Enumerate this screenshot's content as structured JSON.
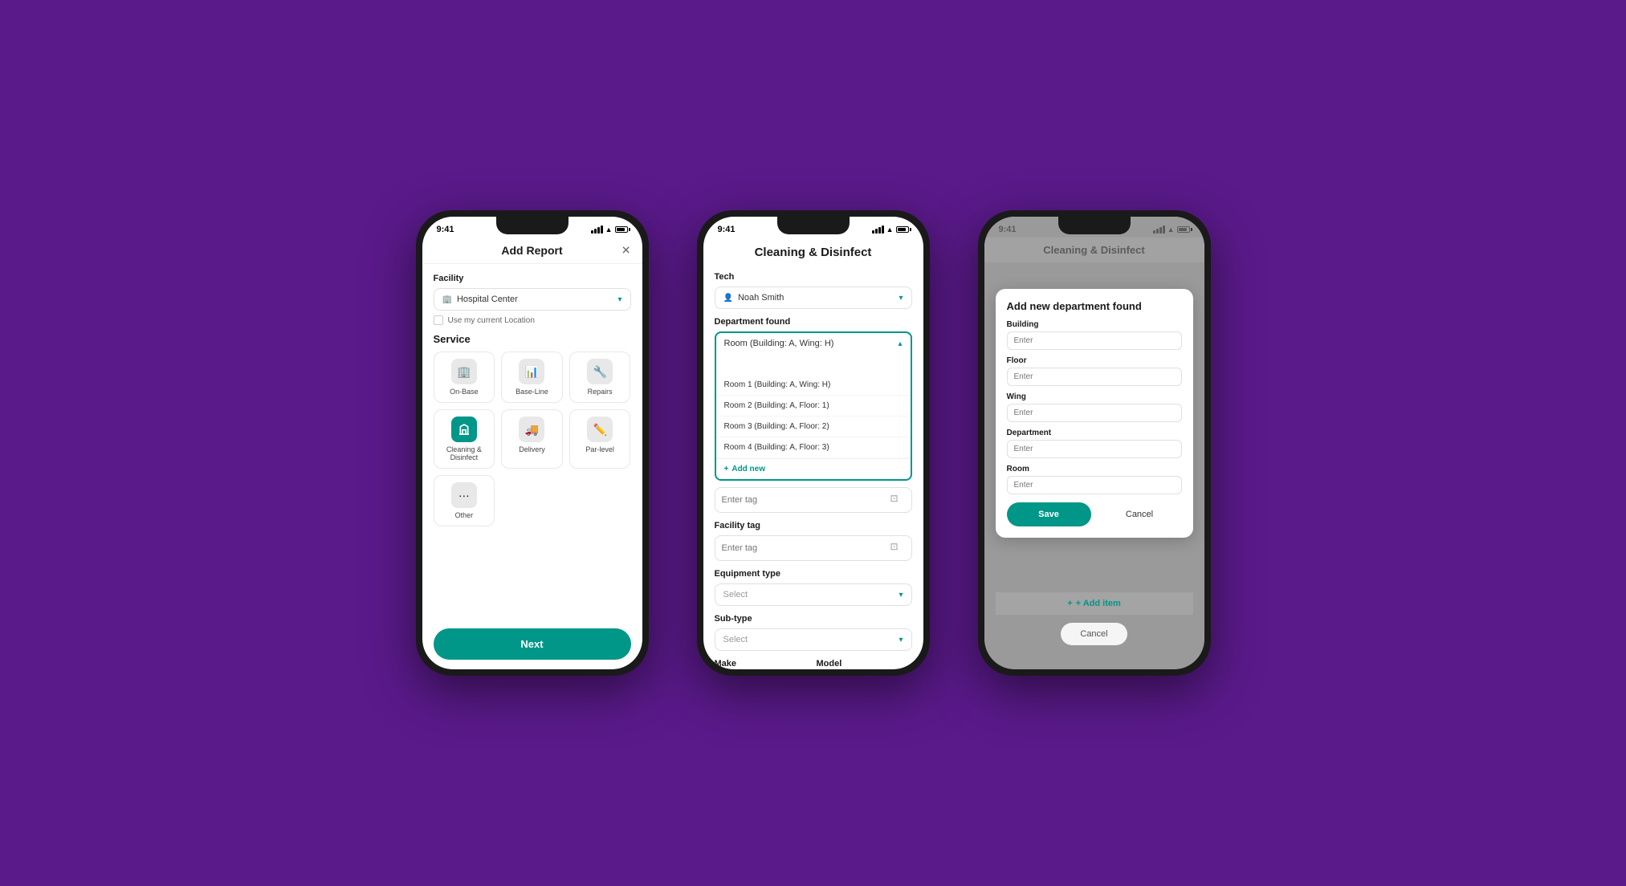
{
  "background": "#5a1a8a",
  "phone1": {
    "status_time": "9:41",
    "title": "Add Report",
    "facility_label": "Facility",
    "facility_value": "Hospital Center",
    "use_location_label": "Use my current Location",
    "service_label": "Service",
    "services": [
      {
        "name": "On-Base",
        "icon": "🏢",
        "teal": false
      },
      {
        "name": "Base-Line",
        "icon": "📊",
        "teal": false
      },
      {
        "name": "Repairs",
        "icon": "🔧",
        "teal": false
      },
      {
        "name": "Cleaning & Disinfect",
        "icon": "🧹",
        "teal": true
      },
      {
        "name": "Delivery",
        "icon": "🚚",
        "teal": false
      },
      {
        "name": "Par-level",
        "icon": "✏️",
        "teal": false
      },
      {
        "name": "Other",
        "icon": "···",
        "teal": false
      }
    ],
    "next_label": "Next"
  },
  "phone2": {
    "status_time": "9:41",
    "title": "Cleaning & Disinfect",
    "tech_label": "Tech",
    "tech_value": "Noah Smith",
    "department_label": "Department found",
    "department_value": "Room (Building: A, Wing: H)",
    "search_placeholder": "",
    "dropdown_items": [
      "Room 1 (Building: A, Wing: H)",
      "Room 2 (Building: A, Floor: 1)",
      "Room 3 (Building: A, Floor: 2)",
      "Room 4 (Building: A, Floor: 3)"
    ],
    "add_new_label": "Add new",
    "enter_tag_placeholder": "Enter tag",
    "facility_tag_label": "Facility tag",
    "equipment_type_label": "Equipment type",
    "equipment_type_placeholder": "Select",
    "sub_type_label": "Sub-type",
    "sub_type_placeholder": "Select",
    "make_label": "Make",
    "model_label": "Model"
  },
  "phone3": {
    "status_time": "9:41",
    "bg_title": "Cleaning & Disinfect",
    "modal_title": "Add new department found",
    "building_label": "Building",
    "building_placeholder": "Enter",
    "floor_label": "Floor",
    "floor_placeholder": "Enter",
    "wing_label": "Wing",
    "wing_placeholder": "Enter",
    "department_label": "Department",
    "department_placeholder": "Enter",
    "room_label": "Room",
    "room_placeholder": "Enter",
    "save_label": "Save",
    "cancel_label": "Cancel",
    "add_item_label": "+ Add item",
    "cancel_footer_label": "Cancel"
  }
}
